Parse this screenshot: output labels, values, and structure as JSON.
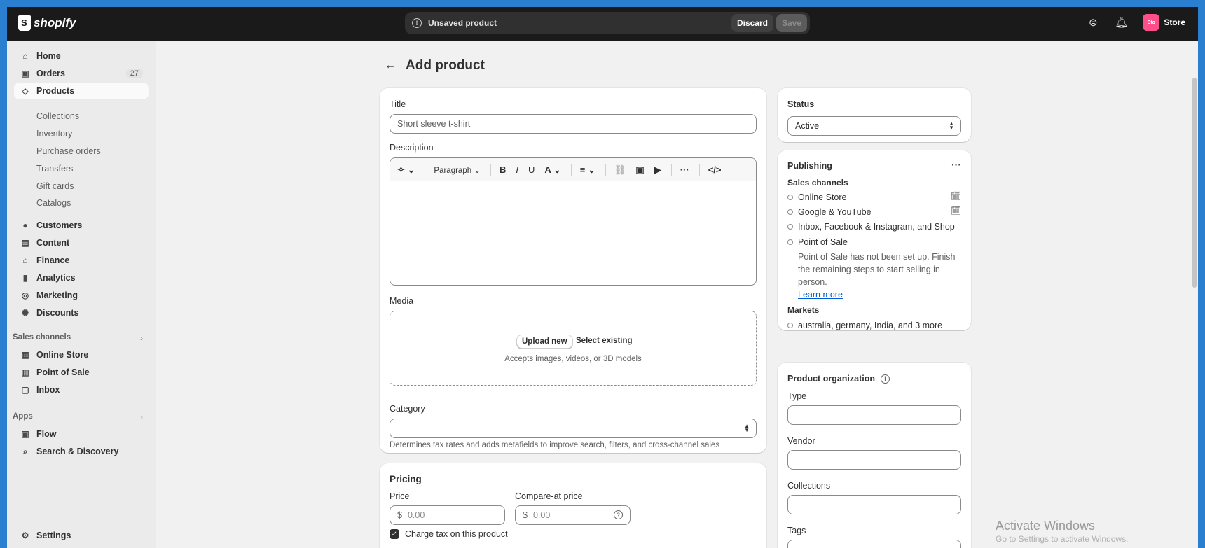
{
  "topbar": {
    "brand": "shopify",
    "unsaved_text": "Unsaved product",
    "discard_label": "Discard",
    "save_label": "Save",
    "store_label": "Store",
    "store_avatar": "Sto"
  },
  "sidebar": {
    "home": "Home",
    "orders": "Orders",
    "orders_count": "27",
    "products": "Products",
    "product_subs": [
      "Collections",
      "Inventory",
      "Purchase orders",
      "Transfers",
      "Gift cards",
      "Catalogs"
    ],
    "customers": "Customers",
    "content": "Content",
    "finance": "Finance",
    "analytics": "Analytics",
    "marketing": "Marketing",
    "discounts": "Discounts",
    "sales_channels_label": "Sales channels",
    "online_store": "Online Store",
    "point_of_sale": "Point of Sale",
    "inbox": "Inbox",
    "apps_label": "Apps",
    "flow": "Flow",
    "search_discovery": "Search & Discovery",
    "settings": "Settings"
  },
  "page": {
    "title": "Add product"
  },
  "product": {
    "title_label": "Title",
    "title_placeholder": "Short sleeve t-shirt",
    "description_label": "Description",
    "paragraph_label": "Paragraph",
    "media_label": "Media",
    "upload_label": "Upload new",
    "select_existing_label": "Select existing",
    "media_hint": "Accepts images, videos, or 3D models",
    "category_label": "Category",
    "category_hint": "Determines tax rates and adds metafields to improve search, filters, and cross-channel sales"
  },
  "pricing": {
    "heading": "Pricing",
    "price_label": "Price",
    "price_currency": "$",
    "price_placeholder": "0.00",
    "compare_label": "Compare-at price",
    "compare_currency": "$",
    "compare_placeholder": "0.00",
    "charge_tax_label": "Charge tax on this product"
  },
  "status": {
    "heading": "Status",
    "value": "Active"
  },
  "publishing": {
    "heading": "Publishing",
    "sales_channels_label": "Sales channels",
    "channels": [
      "Online Store",
      "Google & YouTube",
      "Inbox, Facebook & Instagram, and Shop",
      "Point of Sale"
    ],
    "pos_note_line1": "Point of Sale has not been set up. Finish",
    "pos_note_line2": "the remaining steps to start selling in",
    "pos_note_line3": "person.",
    "learn_more": "Learn more",
    "markets_label": "Markets",
    "markets_value": "australia, germany, India, and 3 more"
  },
  "organization": {
    "heading": "Product organization",
    "type_label": "Type",
    "vendor_label": "Vendor",
    "collections_label": "Collections",
    "tags_label": "Tags"
  },
  "watermark": {
    "line1": "Activate Windows",
    "line2": "Go to Settings to activate Windows."
  },
  "colors": {
    "topbar": "#1a1a1a",
    "accent_link": "#005bd3",
    "store_avatar": "#ff4f8b",
    "frame_border": "#2b7fd0"
  }
}
